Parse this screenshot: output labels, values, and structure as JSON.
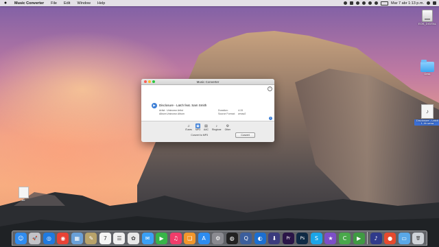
{
  "menubar": {
    "apple": "",
    "items": [
      "Music Converter",
      "File",
      "Edit",
      "Window",
      "Help"
    ],
    "clock": "Mar 7 abr  1:13 p.m."
  },
  "desktop": {
    "icons": [
      {
        "label": "EOS_DIGITAL",
        "icon": "drive-icon"
      },
      {
        "label": "Desk",
        "icon": "folder-icon"
      },
      {
        "label": "Disclosure - Latch f...ith.wma",
        "icon": "music-file-icon"
      },
      {
        "label": "file",
        "icon": "document-icon"
      }
    ]
  },
  "window": {
    "title": "Music Converter",
    "track": {
      "title": "Disclosure - Latch feat. Sam Smith",
      "artist_label": "Artist:",
      "artist": "Unknown Artist",
      "album_label": "Album:",
      "album": "Unknown Album",
      "duration_label": "Duration:",
      "duration": "4:15",
      "format_label": "Source Format:",
      "format": "wmav2"
    },
    "formats": [
      {
        "label": "iTunes",
        "icon": "music-note-icon",
        "glyph": "♫"
      },
      {
        "label": "MP3",
        "icon": "mp3-icon",
        "glyph": "▣",
        "selected": true
      },
      {
        "label": "AAC",
        "icon": "aac-icon",
        "glyph": "▤"
      },
      {
        "label": "Ringtone",
        "icon": "bell-icon",
        "glyph": "♪"
      },
      {
        "label": "Other",
        "icon": "gear-icon",
        "glyph": "⚙"
      }
    ],
    "convert_label": "Convert to MP3",
    "convert_button": "Convert"
  },
  "dock": {
    "apps": [
      {
        "name": "finder-icon",
        "color": "#2f8cf0",
        "glyph": "☺"
      },
      {
        "name": "launchpad-icon",
        "color": "#c3c3c8",
        "glyph": "🚀"
      },
      {
        "name": "safari-icon",
        "color": "#1f7ae0",
        "glyph": "◎"
      },
      {
        "name": "chrome-icon",
        "color": "#e94235",
        "glyph": "◉"
      },
      {
        "name": "preview-icon",
        "color": "#6aa0d8",
        "glyph": "▦"
      },
      {
        "name": "notes-icon",
        "color": "#b9a36a",
        "glyph": "✎"
      },
      {
        "name": "calendar-icon",
        "color": "#f4f4f4",
        "glyph": "7"
      },
      {
        "name": "reminders-icon",
        "color": "#f0f0f0",
        "glyph": "☰"
      },
      {
        "name": "photos-icon",
        "color": "#e8e8e8",
        "glyph": "✿"
      },
      {
        "name": "messages-icon",
        "color": "#3aa0f5",
        "glyph": "✉"
      },
      {
        "name": "facetime-icon",
        "color": "#38b548",
        "glyph": "▶"
      },
      {
        "name": "itunes-icon",
        "color": "#f03c6a",
        "glyph": "♫"
      },
      {
        "name": "ibooks-icon",
        "color": "#f2962b",
        "glyph": "❑"
      },
      {
        "name": "app-store-icon",
        "color": "#2d8cf0",
        "glyph": "A"
      },
      {
        "name": "system-prefs-icon",
        "color": "#8a8a90",
        "glyph": "⚙"
      },
      {
        "name": "camera-icon",
        "color": "#222222",
        "glyph": "◍"
      },
      {
        "name": "quicktime-icon",
        "color": "#3c5e9c",
        "glyph": "Q"
      },
      {
        "name": "browser-icon",
        "color": "#1c6fd0",
        "glyph": "◐"
      },
      {
        "name": "downloader-icon",
        "color": "#3b3b7d",
        "glyph": "⬇"
      },
      {
        "name": "premiere-icon",
        "color": "#2a1547",
        "glyph": "Pr"
      },
      {
        "name": "photoshop-icon",
        "color": "#0f2a44",
        "glyph": "Ps"
      },
      {
        "name": "skype-icon",
        "color": "#1ba5e8",
        "glyph": "S"
      },
      {
        "name": "star-app-icon",
        "color": "#7d4fc8",
        "glyph": "★"
      },
      {
        "name": "c-app-icon",
        "color": "#49a84b",
        "glyph": "C"
      },
      {
        "name": "camtasia-icon",
        "color": "#3f9a42",
        "glyph": "▶"
      },
      {
        "name": "music-app-icon",
        "color": "#2f3a8a",
        "glyph": "♪"
      },
      {
        "name": "misc-app-icon",
        "color": "#e64a2e",
        "glyph": "●"
      },
      {
        "name": "folder-stack-icon",
        "color": "#5aa8e8",
        "glyph": "▭"
      },
      {
        "name": "trash-icon",
        "color": "#cfd3d8",
        "glyph": "🗑"
      }
    ]
  }
}
